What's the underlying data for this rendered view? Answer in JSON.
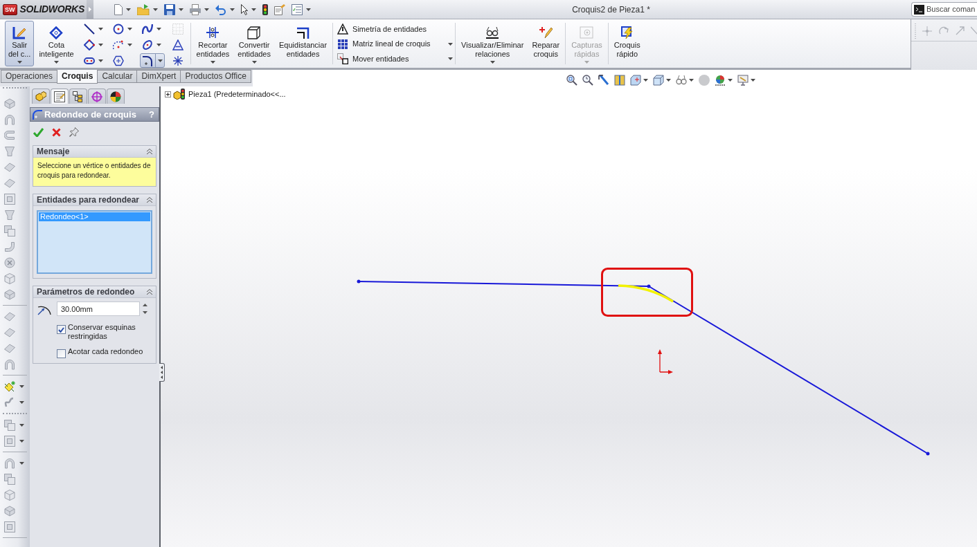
{
  "title_bar": {
    "logo_badge": "SW",
    "logo_text": "SOLIDWORKS",
    "title": "Croquis2 de Pieza1 *",
    "search": {
      "placeholder": "Buscar coman"
    }
  },
  "ribbon": {
    "groups": [
      {
        "items": [
          {
            "kind": "large",
            "label": "Salir\ndel c...",
            "selected": true,
            "dropdown": true,
            "disabled": false
          },
          {
            "kind": "large",
            "label": "Cota\ninteligente",
            "selected": false,
            "dropdown": true,
            "disabled": false
          },
          {
            "kind": "tools",
            "tools": [
              {
                "selected": false,
                "dropdown": true,
                "disabled": false
              },
              {
                "selected": false,
                "dropdown": true,
                "disabled": false
              },
              {
                "selected": false,
                "dropdown": true,
                "disabled": false
              },
              {
                "selected": false,
                "dropdown": false,
                "disabled": true
              },
              {
                "selected": false,
                "dropdown": true,
                "disabled": false
              },
              {
                "selected": false,
                "dropdown": true,
                "disabled": false
              },
              {
                "selected": false,
                "dropdown": true,
                "disabled": false
              },
              {
                "selected": false,
                "dropdown": false,
                "disabled": false
              },
              {
                "selected": false,
                "dropdown": true,
                "disabled": false
              },
              {
                "selected": false,
                "dropdown": false,
                "disabled": false
              },
              {
                "selected": true,
                "dropdown": true,
                "disabled": false
              },
              {
                "selected": false,
                "dropdown": false,
                "disabled": false
              }
            ]
          }
        ]
      },
      {
        "items": [
          {
            "kind": "large",
            "label": "Recortar\nentidades",
            "selected": false,
            "dropdown": true,
            "disabled": false
          },
          {
            "kind": "large",
            "label": "Convertir\nentidades",
            "selected": false,
            "dropdown": true,
            "disabled": false
          },
          {
            "kind": "large",
            "label": "Equidistanciar\nentidades",
            "selected": false,
            "dropdown": false,
            "disabled": false
          }
        ]
      },
      {
        "items": [
          {
            "kind": "stack",
            "entries": [
              {
                "label": "Simetría de entidades",
                "dropdown": false
              },
              {
                "label": "Matriz lineal de croquis",
                "dropdown": true
              },
              {
                "label": "Mover entidades",
                "dropdown": true
              }
            ]
          }
        ]
      },
      {
        "items": [
          {
            "kind": "large",
            "label": "Visualizar/Eliminar\nrelaciones",
            "selected": false,
            "dropdown": true,
            "disabled": false
          },
          {
            "kind": "large",
            "label": "Reparar\ncroquis",
            "selected": false,
            "dropdown": false,
            "disabled": false
          }
        ]
      },
      {
        "items": [
          {
            "kind": "large",
            "label": "Capturas\nrápidas",
            "selected": false,
            "dropdown": true,
            "disabled": true
          }
        ]
      },
      {
        "items": [
          {
            "kind": "large",
            "label": "Croquis\nrápido",
            "selected": false,
            "dropdown": false,
            "disabled": false
          }
        ]
      }
    ]
  },
  "tabs": [
    {
      "label": "Operaciones",
      "selected": false
    },
    {
      "label": "Croquis",
      "selected": true
    },
    {
      "label": "Calcular",
      "selected": false
    },
    {
      "label": "DimXpert",
      "selected": false
    },
    {
      "label": "Productos Office",
      "selected": false
    }
  ],
  "property_manager": {
    "panel_tabs": [
      {
        "selected": false
      },
      {
        "selected": true
      },
      {
        "selected": false
      },
      {
        "selected": false
      },
      {
        "selected": false
      }
    ],
    "title": "Redondeo de croquis",
    "help": "?",
    "sections": [
      {
        "kind": "message",
        "title": "Mensaje",
        "expanded": true,
        "text": "Seleccione un vértice o entidades de croquis para redondear."
      },
      {
        "kind": "list",
        "title": "Entidades para redondear",
        "expanded": true,
        "items": [
          {
            "label": "Redondeo<1>",
            "selected": true
          }
        ]
      },
      {
        "kind": "parameters",
        "title": "Parámetros de redondeo",
        "expanded": true,
        "radius": {
          "value": "30.00mm"
        },
        "options": [
          {
            "label": "Conservar esquinas restringidas",
            "checked": true
          },
          {
            "label": "Acotar cada redondeo",
            "checked": false
          }
        ]
      }
    ]
  },
  "viewport": {
    "feature_tree": {
      "label": "Pieza1 (Predeterminado<<...",
      "expanded": false
    }
  }
}
